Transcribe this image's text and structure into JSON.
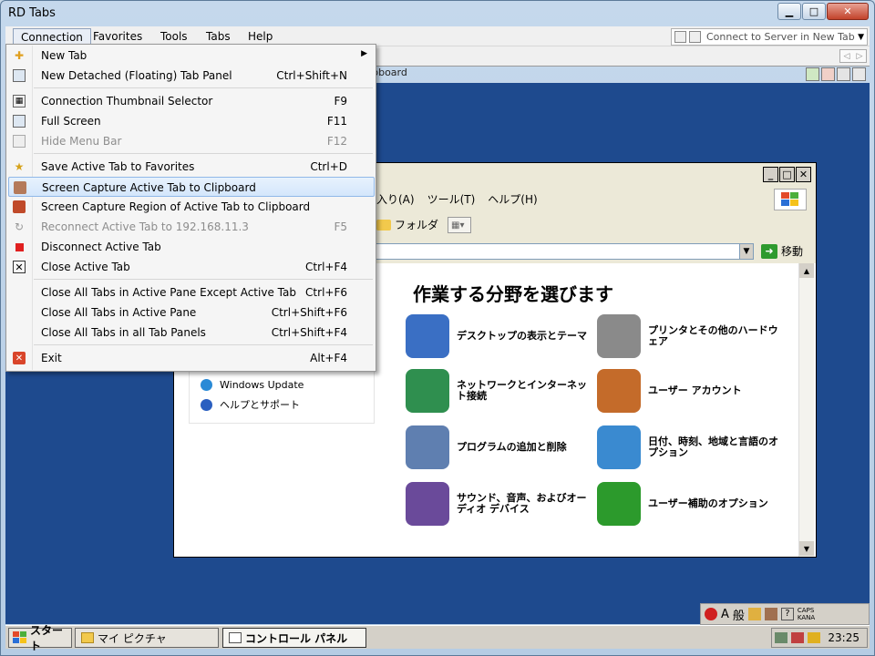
{
  "window": {
    "title": "RD Tabs"
  },
  "menubar": {
    "items": [
      "Connection",
      "Favorites",
      "Tools",
      "Tabs",
      "Help"
    ],
    "connect_placeholder": "Connect to Server in New Tab"
  },
  "tab": {
    "label": "lipboard"
  },
  "connection_menu": {
    "items": [
      {
        "label": "New Tab",
        "shortcut": "",
        "icon": "plus-icon"
      },
      {
        "label": "New Detached (Floating) Tab Panel",
        "shortcut": "Ctrl+Shift+N",
        "icon": "detached-panel-icon"
      },
      {
        "label": "Connection Thumbnail Selector",
        "shortcut": "F9",
        "icon": "thumbnail-grid-icon"
      },
      {
        "label": "Full Screen",
        "shortcut": "F11",
        "icon": "fullscreen-icon"
      },
      {
        "label": "Hide Menu Bar",
        "shortcut": "F12",
        "icon": "hide-menu-icon"
      },
      {
        "label": "Save Active Tab to Favorites",
        "shortcut": "Ctrl+D",
        "icon": "favorite-star-icon"
      },
      {
        "label": "Screen Capture Active Tab to Clipboard",
        "shortcut": "",
        "icon": "camera-icon"
      },
      {
        "label": "Screen Capture Region of Active Tab to Clipboard",
        "shortcut": "",
        "icon": "camera-region-icon"
      },
      {
        "label": "Reconnect Active Tab to 192.168.11.3",
        "shortcut": "F5",
        "icon": "reconnect-icon"
      },
      {
        "label": "Disconnect Active Tab",
        "shortcut": "",
        "icon": "disconnect-icon"
      },
      {
        "label": "Close Active Tab",
        "shortcut": "Ctrl+F4",
        "icon": "close-tab-icon"
      },
      {
        "label": "Close All Tabs in Active Pane Except Active Tab",
        "shortcut": "Ctrl+F6",
        "icon": ""
      },
      {
        "label": "Close All Tabs in Active Pane",
        "shortcut": "Ctrl+Shift+F6",
        "icon": ""
      },
      {
        "label": "Close All Tabs in all Tab Panels",
        "shortcut": "Ctrl+Shift+F4",
        "icon": ""
      },
      {
        "label": "Exit",
        "shortcut": "Alt+F4",
        "icon": "exit-icon"
      }
    ]
  },
  "control_panel": {
    "menu": [
      "入り(A)",
      "ツール(T)",
      "ヘルプ(H)"
    ],
    "folder_label": "フォルダ",
    "go_label": "移動",
    "heading": "作業する分野を選びます",
    "left_links": [
      "Windows Update",
      "ヘルプとサポート"
    ],
    "categories": [
      {
        "label": "デスクトップの表示とテーマ",
        "color": "#3a6fc4"
      },
      {
        "label": "プリンタとその他のハードウェア",
        "color": "#8a8a8a"
      },
      {
        "label": "ネットワークとインターネット接続",
        "color": "#2f8f4f"
      },
      {
        "label": "ユーザー アカウント",
        "color": "#c46b2a"
      },
      {
        "label": "プログラムの追加と削除",
        "color": "#5f7fb0"
      },
      {
        "label": "日付、時刻、地域と言語のオプション",
        "color": "#3a8ad0"
      },
      {
        "label": "サウンド、音声、およびオーディオ デバイス",
        "color": "#6a4a9a"
      },
      {
        "label": "ユーザー補助のオプション",
        "color": "#2c9a2c"
      }
    ]
  },
  "langbar": {
    "mode": "A",
    "text": "般",
    "caps": "CAPS",
    "kana": "KANA"
  },
  "taskbar": {
    "start": "スタート",
    "tasks": [
      "マイ ピクチャ",
      "コントロール パネル"
    ],
    "clock": "23:25"
  }
}
